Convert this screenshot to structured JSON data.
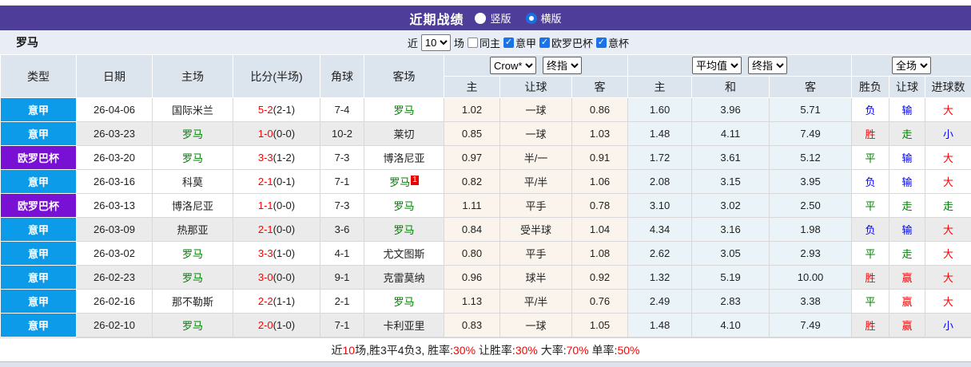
{
  "titlebar": {
    "title": "近期战绩",
    "radio_vertical": "竖版",
    "radio_horizontal": "横版",
    "selected_layout": "横版",
    "bar_color": "#4f3e99"
  },
  "filter": {
    "team": "罗马",
    "near_label": "近",
    "matches_value": "10",
    "games_label": "场",
    "same_home_label": "同主",
    "same_home_checked": false,
    "league_filters": [
      {
        "label": "意甲",
        "checked": true
      },
      {
        "label": "欧罗巴杯",
        "checked": true
      },
      {
        "label": "意杯",
        "checked": true
      }
    ]
  },
  "table": {
    "main_headers": [
      "类型",
      "日期",
      "主场",
      "比分(半场)",
      "角球",
      "客场"
    ],
    "selects": {
      "crow": "Crow*",
      "crow_final": "终指",
      "average": "平均值",
      "avg_final": "终指",
      "full_match": "全场"
    },
    "sub_headers": [
      "主",
      "让球",
      "客",
      "主",
      "和",
      "客",
      "胜负",
      "让球",
      "进球数"
    ],
    "colors": {
      "serie_a_badge": "#0b9be9",
      "europa_badge": "#7911d5",
      "roma_green": "#008000",
      "win_red": "#ff0000",
      "draw_green": "#008000",
      "loss_blue": "#0000ff",
      "score_red": "#ff0000"
    },
    "rows": [
      {
        "league": "意甲",
        "league_color": "#0b9be9",
        "date": "26-04-06",
        "home": "国际米兰",
        "home_color": "#222222",
        "home_badge": "",
        "score": "5-2",
        "half": "(2-1)",
        "corner": "7-4",
        "away": "罗马",
        "away_color": "#008000",
        "away_badge": "",
        "crow_home": "1.02",
        "crow_line": "一球",
        "crow_away": "0.86",
        "euro_home": "1.60",
        "euro_draw": "3.96",
        "euro_away": "5.71",
        "outcome": "负",
        "outcome_color": "#0000ff",
        "handicap": "输",
        "handicap_color": "#0000ff",
        "goals": "大",
        "goals_color": "#ff0000",
        "shaded": false
      },
      {
        "league": "意甲",
        "league_color": "#0b9be9",
        "date": "26-03-23",
        "home": "罗马",
        "home_color": "#008000",
        "home_badge": "",
        "score": "1-0",
        "half": "(0-0)",
        "corner": "10-2",
        "away": "莱切",
        "away_color": "#222222",
        "away_badge": "",
        "crow_home": "0.85",
        "crow_line": "一球",
        "crow_away": "1.03",
        "euro_home": "1.48",
        "euro_draw": "4.11",
        "euro_away": "7.49",
        "outcome": "胜",
        "outcome_color": "#ff0000",
        "handicap": "走",
        "handicap_color": "#008000",
        "goals": "小",
        "goals_color": "#0000ff",
        "shaded": true
      },
      {
        "league": "欧罗巴杯",
        "league_color": "#7911d5",
        "date": "26-03-20",
        "home": "罗马",
        "home_color": "#008000",
        "home_badge": "",
        "score": "3-3",
        "half": "(1-2)",
        "corner": "7-3",
        "away": "博洛尼亚",
        "away_color": "#222222",
        "away_badge": "",
        "crow_home": "0.97",
        "crow_line": "半/一",
        "crow_away": "0.91",
        "euro_home": "1.72",
        "euro_draw": "3.61",
        "euro_away": "5.12",
        "outcome": "平",
        "outcome_color": "#008000",
        "handicap": "输",
        "handicap_color": "#0000ff",
        "goals": "大",
        "goals_color": "#ff0000",
        "shaded": false
      },
      {
        "league": "意甲",
        "league_color": "#0b9be9",
        "date": "26-03-16",
        "home": "科莫",
        "home_color": "#222222",
        "home_badge": "",
        "score": "2-1",
        "half": "(0-1)",
        "corner": "7-1",
        "away": "罗马",
        "away_color": "#008000",
        "away_badge": "1",
        "crow_home": "0.82",
        "crow_line": "平/半",
        "crow_away": "1.06",
        "euro_home": "2.08",
        "euro_draw": "3.15",
        "euro_away": "3.95",
        "outcome": "负",
        "outcome_color": "#0000ff",
        "handicap": "输",
        "handicap_color": "#0000ff",
        "goals": "大",
        "goals_color": "#ff0000",
        "shaded": false
      },
      {
        "league": "欧罗巴杯",
        "league_color": "#7911d5",
        "date": "26-03-13",
        "home": "博洛尼亚",
        "home_color": "#222222",
        "home_badge": "",
        "score": "1-1",
        "half": "(0-0)",
        "corner": "7-3",
        "away": "罗马",
        "away_color": "#008000",
        "away_badge": "",
        "crow_home": "1.11",
        "crow_line": "平手",
        "crow_away": "0.78",
        "euro_home": "3.10",
        "euro_draw": "3.02",
        "euro_away": "2.50",
        "outcome": "平",
        "outcome_color": "#008000",
        "handicap": "走",
        "handicap_color": "#008000",
        "goals": "走",
        "goals_color": "#008000",
        "shaded": false
      },
      {
        "league": "意甲",
        "league_color": "#0b9be9",
        "date": "26-03-09",
        "home": "热那亚",
        "home_color": "#222222",
        "home_badge": "",
        "score": "2-1",
        "half": "(0-0)",
        "corner": "3-6",
        "away": "罗马",
        "away_color": "#008000",
        "away_badge": "",
        "crow_home": "0.84",
        "crow_line": "受半球",
        "crow_away": "1.04",
        "euro_home": "4.34",
        "euro_draw": "3.16",
        "euro_away": "1.98",
        "outcome": "负",
        "outcome_color": "#0000ff",
        "handicap": "输",
        "handicap_color": "#0000ff",
        "goals": "大",
        "goals_color": "#ff0000",
        "shaded": true
      },
      {
        "league": "意甲",
        "league_color": "#0b9be9",
        "date": "26-03-02",
        "home": "罗马",
        "home_color": "#008000",
        "home_badge": "",
        "score": "3-3",
        "half": "(1-0)",
        "corner": "4-1",
        "away": "尤文图斯",
        "away_color": "#222222",
        "away_badge": "",
        "crow_home": "0.80",
        "crow_line": "平手",
        "crow_away": "1.08",
        "euro_home": "2.62",
        "euro_draw": "3.05",
        "euro_away": "2.93",
        "outcome": "平",
        "outcome_color": "#008000",
        "handicap": "走",
        "handicap_color": "#008000",
        "goals": "大",
        "goals_color": "#ff0000",
        "shaded": false
      },
      {
        "league": "意甲",
        "league_color": "#0b9be9",
        "date": "26-02-23",
        "home": "罗马",
        "home_color": "#008000",
        "home_badge": "",
        "score": "3-0",
        "half": "(0-0)",
        "corner": "9-1",
        "away": "克雷莫纳",
        "away_color": "#222222",
        "away_badge": "",
        "crow_home": "0.96",
        "crow_line": "球半",
        "crow_away": "0.92",
        "euro_home": "1.32",
        "euro_draw": "5.19",
        "euro_away": "10.00",
        "outcome": "胜",
        "outcome_color": "#ff0000",
        "handicap": "赢",
        "handicap_color": "#ff0000",
        "goals": "大",
        "goals_color": "#ff0000",
        "shaded": true
      },
      {
        "league": "意甲",
        "league_color": "#0b9be9",
        "date": "26-02-16",
        "home": "那不勒斯",
        "home_color": "#222222",
        "home_badge": "",
        "score": "2-2",
        "half": "(1-1)",
        "corner": "2-1",
        "away": "罗马",
        "away_color": "#008000",
        "away_badge": "",
        "crow_home": "1.13",
        "crow_line": "平/半",
        "crow_away": "0.76",
        "euro_home": "2.49",
        "euro_draw": "2.83",
        "euro_away": "3.38",
        "outcome": "平",
        "outcome_color": "#008000",
        "handicap": "赢",
        "handicap_color": "#ff0000",
        "goals": "大",
        "goals_color": "#ff0000",
        "shaded": false
      },
      {
        "league": "意甲",
        "league_color": "#0b9be9",
        "date": "26-02-10",
        "home": "罗马",
        "home_color": "#008000",
        "home_badge": "",
        "score": "2-0",
        "half": "(1-0)",
        "corner": "7-1",
        "away": "卡利亚里",
        "away_color": "#222222",
        "away_badge": "",
        "crow_home": "0.83",
        "crow_line": "一球",
        "crow_away": "1.05",
        "euro_home": "1.48",
        "euro_draw": "4.10",
        "euro_away": "7.49",
        "outcome": "胜",
        "outcome_color": "#ff0000",
        "handicap": "赢",
        "handicap_color": "#ff0000",
        "goals": "小",
        "goals_color": "#0000ff",
        "shaded": true
      }
    ]
  },
  "footer": {
    "parts": [
      {
        "text": "近",
        "red": false
      },
      {
        "text": "10",
        "red": true
      },
      {
        "text": "场,胜3平4负3, 胜率:",
        "red": false
      },
      {
        "text": "30%",
        "red": true
      },
      {
        "text": " 让胜率:",
        "red": false
      },
      {
        "text": "30%",
        "red": true
      },
      {
        "text": " 大率:",
        "red": false
      },
      {
        "text": "70%",
        "red": true
      },
      {
        "text": " 单率:",
        "red": false
      },
      {
        "text": "50%",
        "red": true
      }
    ]
  }
}
